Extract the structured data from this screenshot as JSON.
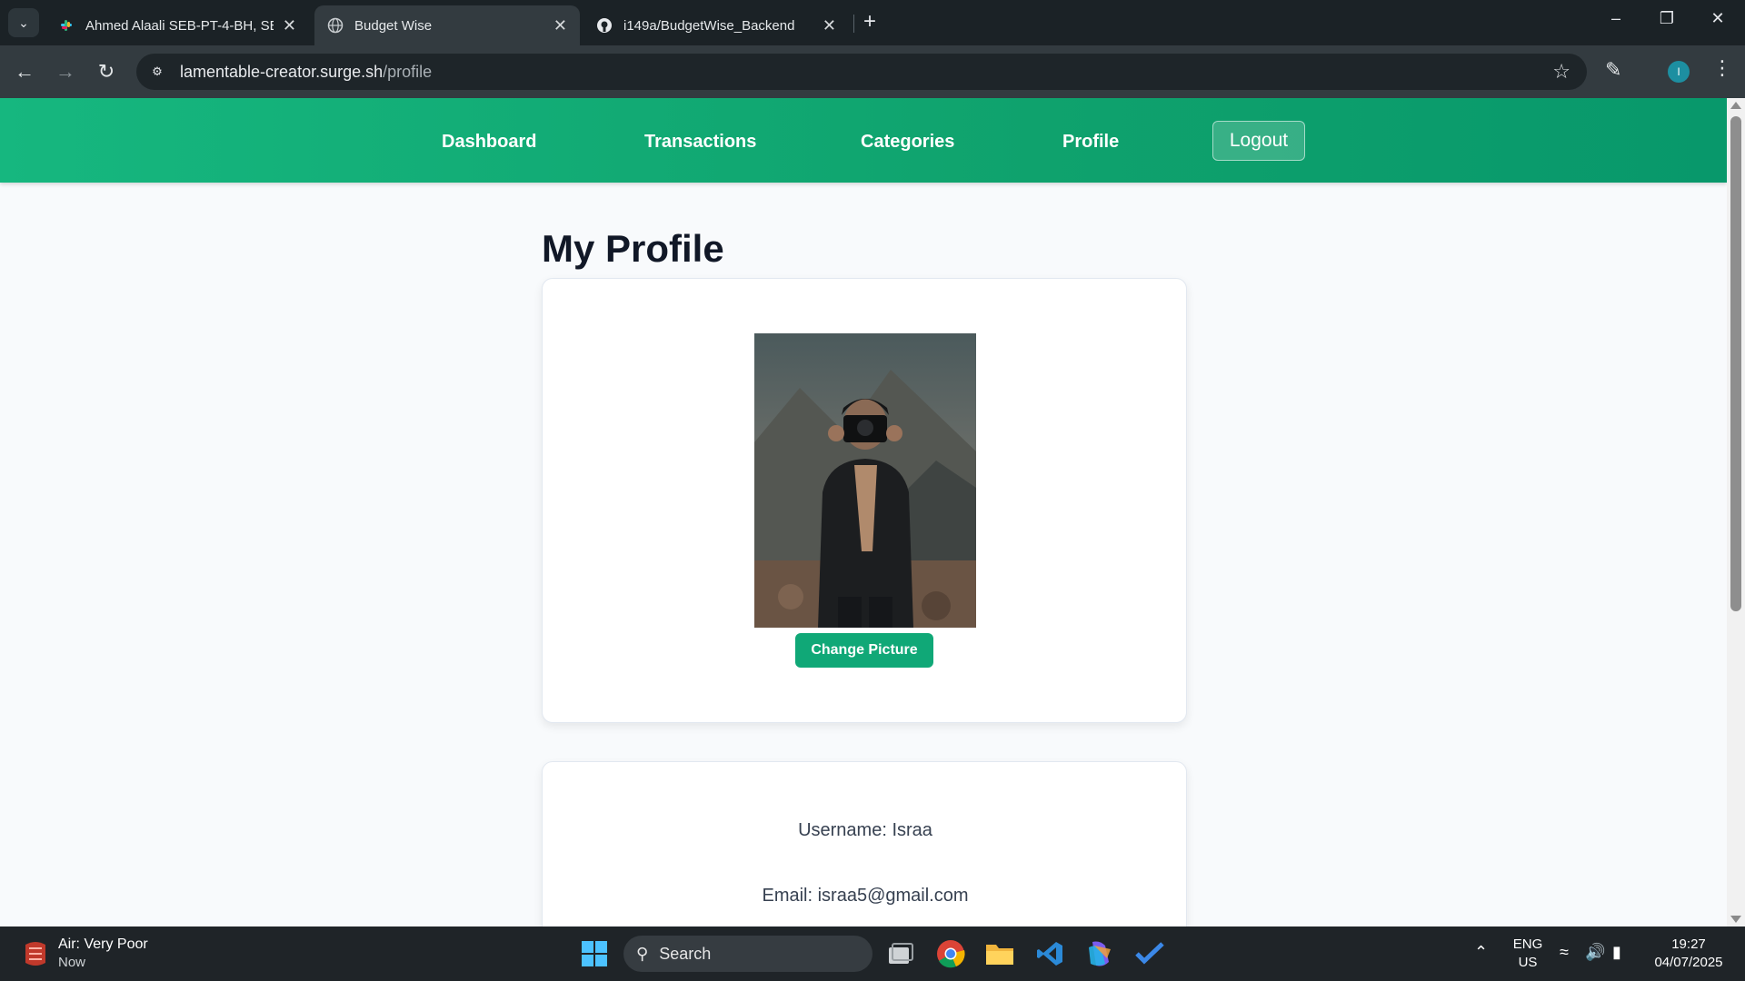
{
  "browser": {
    "tabs": [
      {
        "title": "Ahmed Alaali SEB-PT-4-BH, SEB",
        "active": false
      },
      {
        "title": "Budget Wise",
        "active": true
      },
      {
        "title": "i149a/BudgetWise_Backend",
        "active": false
      }
    ],
    "url_host": "lamentable-creator.surge.sh",
    "url_path": "/profile",
    "profile_initial": "I"
  },
  "app": {
    "nav": {
      "dashboard": "Dashboard",
      "transactions": "Transactions",
      "categories": "Categories",
      "profile": "Profile",
      "logout": "Logout"
    },
    "page_title": "My Profile",
    "change_picture": "Change Picture",
    "username_line": "Username: Israa",
    "email_line": "Email: israa5@gmail.com"
  },
  "taskbar": {
    "weather_title": "Air: Very Poor",
    "weather_sub": "Now",
    "search_label": "Search",
    "lang": "ENG",
    "region": "US",
    "time": "19:27",
    "date": "04/07/2025"
  },
  "colors": {
    "nav_green": "#10a877",
    "accent": "#10a877"
  }
}
